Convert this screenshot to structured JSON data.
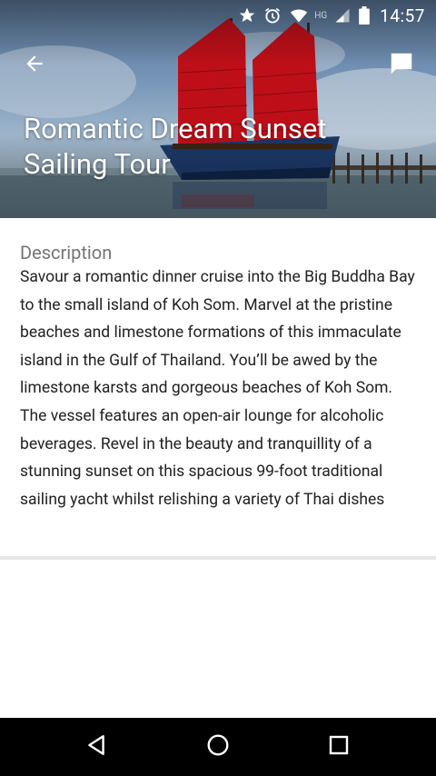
{
  "status_bar": {
    "network_label": "HG",
    "time": "14:57",
    "icons": [
      "star-icon",
      "alarm-icon",
      "wifi-icon",
      "signal-icon",
      "battery-icon"
    ]
  },
  "toolbar": {
    "back_icon": "arrow-back-icon",
    "comment_icon": "chat-bubble-icon"
  },
  "hero": {
    "title": "Romantic Dream Sunset Sailing Tour"
  },
  "description": {
    "heading": "Description",
    "text": "Savour a romantic dinner cruise into the Big Buddha Bay to the small island of Koh Som. Marvel at the pristine beaches and limestone formations of this immaculate island in the Gulf of Thailand. You’ll be awed by the limestone karsts and gorgeous beaches of Koh Som. The vessel features an open-air lounge for alcoholic beverages. Revel in the beauty and tranquillity of a stunning sunset on this spacious 99-foot traditional sailing yacht whilst relishing a variety of Thai dishes"
  },
  "nav_bar": {
    "buttons": [
      "back-triangle-icon",
      "home-circle-icon",
      "recents-square-icon"
    ]
  },
  "colors": {
    "sail_red": "#c8101a",
    "hull_blue": "#1d3a6b",
    "heading_gray": "#757575",
    "body_text": "#212121"
  }
}
